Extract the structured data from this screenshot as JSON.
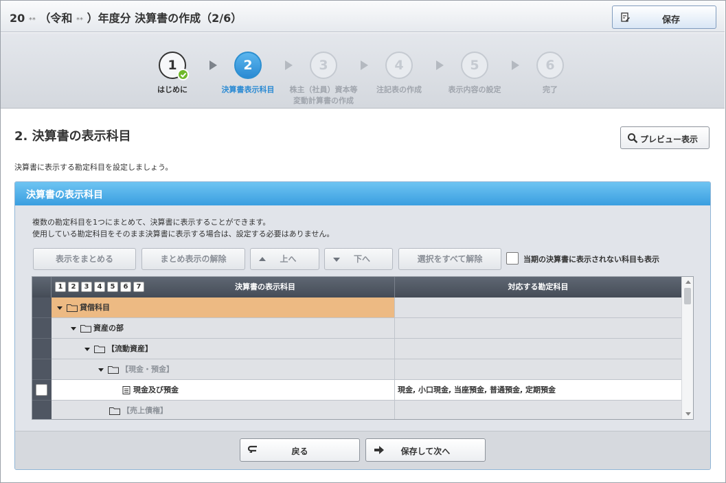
{
  "header": {
    "title_part1": "20",
    "masked": "**",
    "title_part2": "（令和",
    "title_part3": "）年度分 決算書の作成（2/6）",
    "save_label": "保存"
  },
  "steps": [
    {
      "number": "1",
      "label": "はじめに",
      "state": "done"
    },
    {
      "number": "2",
      "label": "決算書表示科目",
      "state": "active"
    },
    {
      "number": "3",
      "label": "株主（社員）資本等",
      "label2": "変動計算書の作成",
      "state": "todo"
    },
    {
      "number": "4",
      "label": "注記表の作成",
      "state": "todo"
    },
    {
      "number": "5",
      "label": "表示内容の設定",
      "state": "todo"
    },
    {
      "number": "6",
      "label": "完了",
      "state": "todo"
    }
  ],
  "section": {
    "title": "2. 決算書の表示科目",
    "preview_label": "プレビュー表示",
    "intro": "決算書に表示する勘定科目を設定しましょう。"
  },
  "panel": {
    "title": "決算書の表示科目",
    "desc_line1": "複数の勘定科目を1つにまとめて、決算書に表示することができます。",
    "desc_line2": "使用している勘定科目をそのまま決算書に表示する場合は、設定する必要はありません。",
    "toolbar": {
      "combine": "表示をまとめる",
      "uncombine": "まとめ表示の解除",
      "up": "上へ",
      "down": "下へ",
      "deselect_all": "選択をすべて解除",
      "show_hidden_label": "当期の決算書に表示されない科目も表示",
      "show_hidden_checked": false
    },
    "grid": {
      "levels": [
        "1",
        "2",
        "3",
        "4",
        "5",
        "6",
        "7"
      ],
      "col1_header": "決算書の表示科目",
      "col2_header": "対応する勘定科目",
      "rows": [
        {
          "label": "貸借科目",
          "accounts": ""
        },
        {
          "label": "資産の部",
          "accounts": ""
        },
        {
          "label": "【流動資産】",
          "accounts": ""
        },
        {
          "label": "【現金・預金】",
          "accounts": ""
        },
        {
          "label": "現金及び預金",
          "accounts": "現金, 小口現金, 当座預金, 普通預金, 定期預金"
        },
        {
          "label": "【売上債権】",
          "accounts": ""
        }
      ]
    },
    "footer": {
      "back_label": "戻る",
      "next_label": "保存して次へ"
    }
  },
  "colors": {
    "accent": "#3a9ee0",
    "selected_row": "#edba83",
    "step_done_check": "#6fb82a"
  }
}
